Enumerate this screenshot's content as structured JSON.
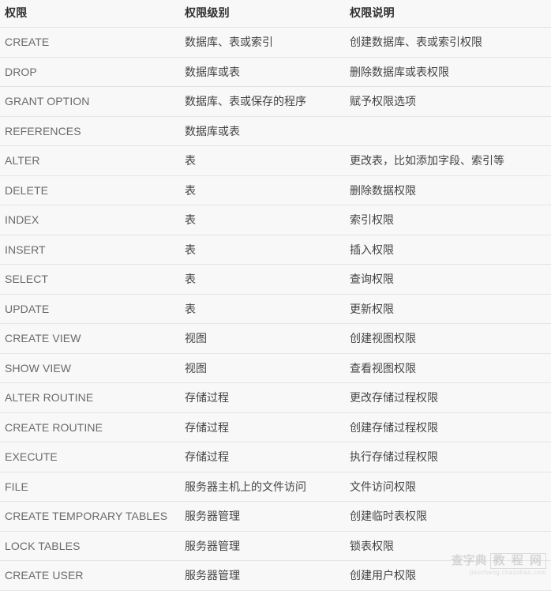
{
  "table": {
    "headers": {
      "privilege": "权限",
      "level": "权限级别",
      "description": "权限说明"
    },
    "rows": [
      {
        "privilege": "CREATE",
        "level": "数据库、表或索引",
        "description": "创建数据库、表或索引权限"
      },
      {
        "privilege": "DROP",
        "level": "数据库或表",
        "description": "删除数据库或表权限"
      },
      {
        "privilege": "GRANT OPTION",
        "level": "数据库、表或保存的程序",
        "description": "赋予权限选项"
      },
      {
        "privilege": "REFERENCES",
        "level": "数据库或表",
        "description": ""
      },
      {
        "privilege": "ALTER",
        "level": "表",
        "description": "更改表，比如添加字段、索引等"
      },
      {
        "privilege": "DELETE",
        "level": "表",
        "description": "删除数据权限"
      },
      {
        "privilege": "INDEX",
        "level": "表",
        "description": "索引权限"
      },
      {
        "privilege": "INSERT",
        "level": "表",
        "description": "插入权限"
      },
      {
        "privilege": "SELECT",
        "level": "表",
        "description": "查询权限"
      },
      {
        "privilege": "UPDATE",
        "level": "表",
        "description": "更新权限"
      },
      {
        "privilege": "CREATE VIEW",
        "level": "视图",
        "description": "创建视图权限"
      },
      {
        "privilege": "SHOW VIEW",
        "level": "视图",
        "description": "查看视图权限"
      },
      {
        "privilege": "ALTER ROUTINE",
        "level": "存储过程",
        "description": "更改存储过程权限"
      },
      {
        "privilege": "CREATE ROUTINE",
        "level": "存储过程",
        "description": "创建存储过程权限"
      },
      {
        "privilege": "EXECUTE",
        "level": "存储过程",
        "description": "执行存储过程权限"
      },
      {
        "privilege": "FILE",
        "level": "服务器主机上的文件访问",
        "description": "文件访问权限"
      },
      {
        "privilege": "CREATE TEMPORARY TABLES",
        "level": "服务器管理",
        "description": "创建临时表权限"
      },
      {
        "privilege": "LOCK TABLES",
        "level": "服务器管理",
        "description": "锁表权限"
      },
      {
        "privilege": "CREATE USER",
        "level": "服务器管理",
        "description": "创建用户权限"
      }
    ]
  },
  "watermark": {
    "brand": "查字典",
    "label": "教 程 网",
    "url": "jiaocheng.chazidian.com"
  },
  "colors": {
    "background": "#f8f8f8",
    "divider": "#e4e4e4",
    "header_text": "#2f2f2f",
    "privilege_text": "#6a6a6a",
    "body_text": "#444444"
  }
}
